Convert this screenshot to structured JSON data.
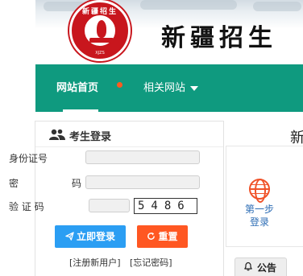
{
  "header": {
    "site_title": "新疆招生",
    "emblem_text": "新疆招生",
    "emblem_sub": "XJZS"
  },
  "nav": {
    "items": [
      {
        "label": "网站首页",
        "active": true
      },
      {
        "label": "相关网站",
        "dropdown": true
      }
    ]
  },
  "login": {
    "title": "考生登录",
    "fields": {
      "id_label": "身份证号",
      "pwd_label_1": "密",
      "pwd_label_2": "码",
      "captcha_label": "验 证 码"
    },
    "id_value": "",
    "password_value": "",
    "captcha_input_value": "",
    "captcha_image_text": "5486",
    "buttons": {
      "login": "立即登录",
      "reset": "重置"
    },
    "links": {
      "register": "[注册新用户]",
      "forgot": "[忘记密码]"
    }
  },
  "right": {
    "heading": "新",
    "step_text": "第一步\n登录",
    "notice_tab": "公告"
  },
  "colors": {
    "nav_bg": "#0f9a7f",
    "login_button": "#2b9ef3",
    "reset_button": "#ff5722",
    "step_icon": "#f0532a",
    "emblem": "#c8161d"
  },
  "icons": [
    "users-icon",
    "paper-plane-icon",
    "refresh-icon",
    "globe-icon",
    "bell-icon",
    "chevron-down-icon"
  ]
}
